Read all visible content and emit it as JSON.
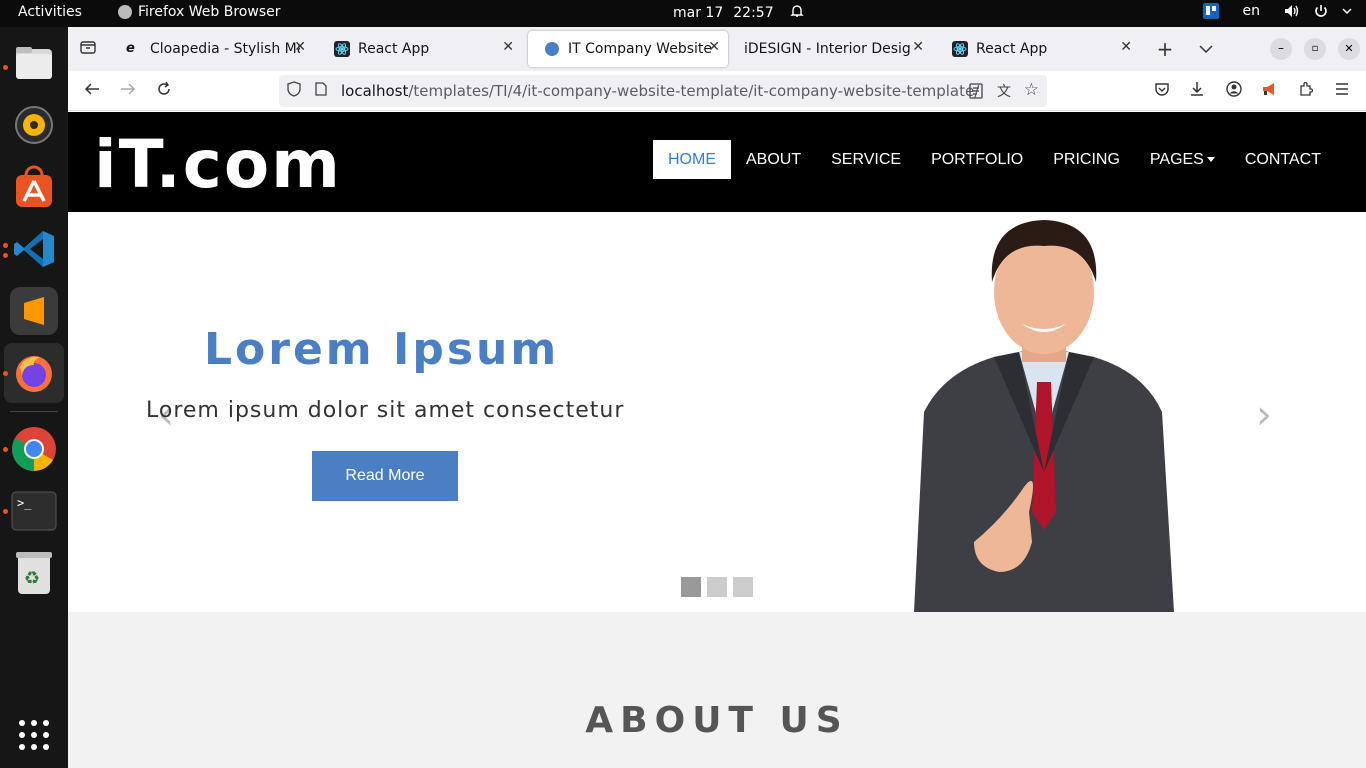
{
  "topbar": {
    "activities": "Activities",
    "app_name": "Firefox Web Browser",
    "date": "mar 17",
    "time": "22:57",
    "lang": "en"
  },
  "dock": {
    "apps": [
      "files",
      "rhythmbox",
      "app-center",
      "vscode",
      "sublime-text",
      "firefox",
      "chrome",
      "terminal",
      "trash",
      "show-apps"
    ]
  },
  "tabs": [
    {
      "label": "Cloapedia - Stylish Magazine",
      "active": false
    },
    {
      "label": "React App",
      "active": false
    },
    {
      "label": "IT Company Website Template",
      "active": true
    },
    {
      "label": "iDESIGN - Interior Design",
      "active": false
    },
    {
      "label": "React App",
      "active": false
    }
  ],
  "url": {
    "host": "localhost",
    "path": "/templates/TI/4/it-company-website-template/it-company-website-template/"
  },
  "site": {
    "logo": "iT.com",
    "menu": [
      "HOME",
      "ABOUT",
      "SERVICE",
      "PORTFOLIO",
      "PRICING",
      "PAGES",
      "CONTACT"
    ],
    "active_menu": "HOME"
  },
  "hero": {
    "title": "Lorem Ipsum",
    "subtitle": "Lorem ipsum dolor sit amet consectetur",
    "button": "Read More",
    "slides": 3,
    "current_slide": 1,
    "prev_glyph": "‹",
    "next_glyph": "›"
  },
  "about": {
    "title": "ABOUT US",
    "teaser": ""
  },
  "colors": {
    "accent": "#4a7fc4",
    "header_bg": "#000000"
  }
}
